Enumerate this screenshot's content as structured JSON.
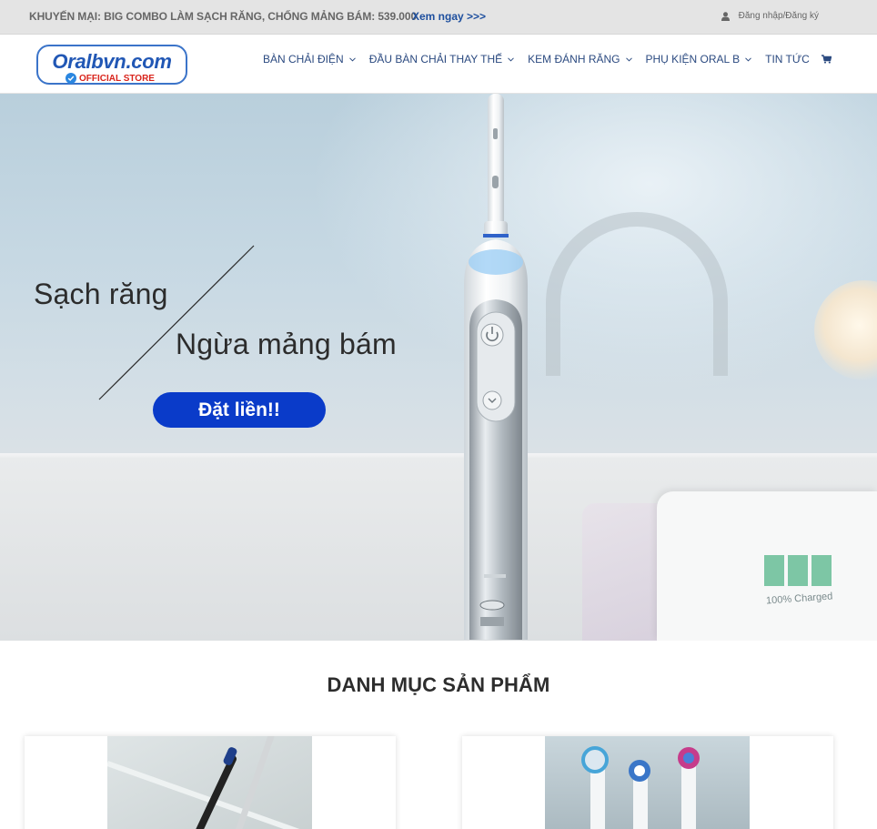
{
  "topbar": {
    "promo_text": "KHUYẾN MẠI: BIG COMBO LÀM SẠCH RĂNG, CHỐNG MẢNG BÁM: 539.000",
    "promo_link": "Xem ngay >>>",
    "login_label": "Đăng nhập/Đăng ký",
    "login_icon": "user-icon"
  },
  "logo": {
    "name": "Oralbvn.com",
    "sub": "OFFICIAL STORE"
  },
  "nav": {
    "items": [
      {
        "label": "BÀN CHẢI ĐIỆN",
        "has_dropdown": true
      },
      {
        "label": "ĐẦU BÀN CHẢI THAY THẾ",
        "has_dropdown": true
      },
      {
        "label": "KEM ĐÁNH RĂNG",
        "has_dropdown": true
      },
      {
        "label": "PHỤ KIỆN ORAL B",
        "has_dropdown": true
      },
      {
        "label": "TIN TỨC",
        "has_dropdown": false
      }
    ],
    "cart_icon": "cart-icon"
  },
  "hero": {
    "title_line1": "Sạch răng",
    "title_line2": "Ngừa mảng bám",
    "cta_label": "Đặt liền!!",
    "charger_text": "100% Charged"
  },
  "section": {
    "title": "DANH MỤC SẢN PHẨM"
  },
  "colors": {
    "nav_text": "#2b4a80",
    "promo_link": "#1e4f9e",
    "cta_bg": "#0a3bc9",
    "topbar_bg": "#e4e4e4"
  }
}
